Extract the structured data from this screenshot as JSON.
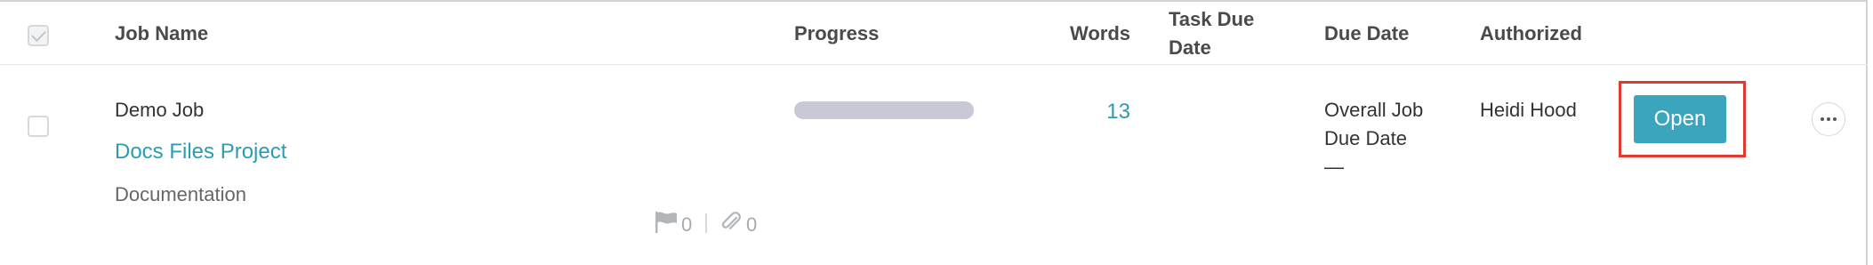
{
  "header": {
    "job_name": "Job Name",
    "progress": "Progress",
    "words": "Words",
    "task_due_date_line1": "Task Due",
    "task_due_date_line2": "Date",
    "due_date": "Due Date",
    "authorized": "Authorized"
  },
  "row": {
    "job_name": "Demo Job",
    "project": "Docs Files Project",
    "job_type": "Documentation",
    "progress_fraction": 0,
    "words": "13",
    "task_due_date": "",
    "due_date_line1": "Overall Job",
    "due_date_line2": "Due Date",
    "due_date_value": "—",
    "authorized": "Heidi Hood",
    "open_label": "Open",
    "flags_count": "0",
    "attachments_count": "0"
  },
  "colors": {
    "accent": "#3aa5bd",
    "link": "#2b9cb4",
    "highlight": "#e23a2f"
  },
  "icons": {
    "flag": "flag-icon",
    "attachment": "paperclip-icon",
    "more": "more-horizontal-icon"
  }
}
